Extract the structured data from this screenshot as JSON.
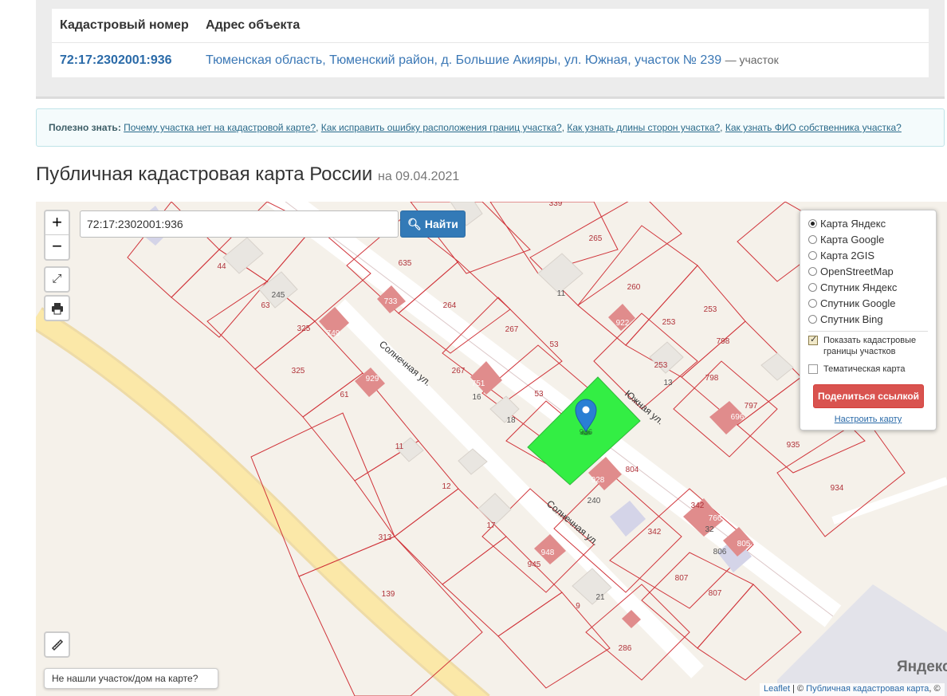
{
  "table": {
    "header_cadastral": "Кадастровый номер",
    "header_address": "Адрес объекта",
    "cadastral_number": "72:17:2302001:936",
    "address": "Тюменская область, Тюменский район, д. Большие Акияры, ул. Южная, участок № 239",
    "object_type": "— участок"
  },
  "useful": {
    "label": "Полезно знать:",
    "links": [
      "Почему участка нет на кадастровой карте?",
      "Как исправить ошибку расположения границ участка?",
      "Как узнать длины сторон участка?",
      "Как узнать ФИО собственника участка?"
    ]
  },
  "page": {
    "title": "Публичная кадастровая карта России",
    "date": "на 09.04.2021"
  },
  "map": {
    "search_value": "72:17:2302001:936",
    "search_button": "Найти",
    "zoom_in": "+",
    "zoom_out": "−",
    "layers": [
      "Карта Яндекс",
      "Карта Google",
      "Карта 2GIS",
      "OpenStreetMap",
      "Спутник Яндекс",
      "Спутник Google",
      "Спутник Bing"
    ],
    "selected_layer": "Карта Яндекс",
    "show_borders_label": "Показать кадастровые границы участков",
    "thematic_label": "Тематическая карта",
    "share_button": "Поделиться ссылкой",
    "configure_link": "Настроить карту",
    "not_found_button": "Не нашли участок/дом на карте?",
    "brand": "Яндекс",
    "attribution_leaflet": "Leaflet",
    "attribution_sep": " | © ",
    "attribution_pkk": "Публичная кадастровая карта",
    "attribution_tail": ", ©",
    "street_solnechnaya": "Солнечная ул.",
    "street_yuzhnaya": "Южная ул.",
    "highlighted_parcel": "936",
    "parcel_labels": [
      "339",
      "265",
      "44",
      "635",
      "245",
      "63",
      "733",
      "264",
      "11",
      "260",
      "253",
      "325",
      "749",
      "325",
      "267",
      "922",
      "253",
      "798",
      "253",
      "13",
      "798",
      "61",
      "929",
      "267",
      "751",
      "16",
      "53",
      "53",
      "18",
      "797",
      "696",
      "11",
      "935",
      "12",
      "928",
      "804",
      "240",
      "934",
      "17",
      "342",
      "766",
      "32",
      "313",
      "342",
      "806",
      "805",
      "948",
      "945",
      "807",
      "139",
      "21",
      "807",
      "9",
      "286"
    ],
    "colors": {
      "highlight": "#33ee44",
      "border": "#d0343a",
      "road": "#fbe8a8",
      "building": "#e9e6e1",
      "red_building": "#e08c8c"
    }
  }
}
